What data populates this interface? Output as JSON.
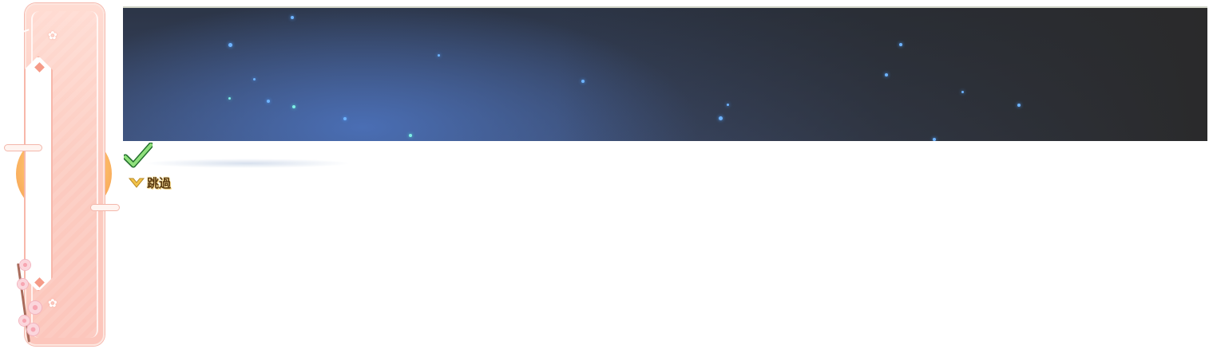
{
  "skip": {
    "label": "跳過"
  },
  "colors": {
    "banner_dark": "#2a2a2b",
    "banner_blue": "#3b4a6b",
    "scroll_pink": "#fccbc0",
    "check_green": "#3fb54a",
    "skip_gold": "#f2c24a"
  },
  "icons": {
    "check": "check-icon",
    "skip": "chevron-down-icon",
    "scroll": "scroll-ornament"
  }
}
